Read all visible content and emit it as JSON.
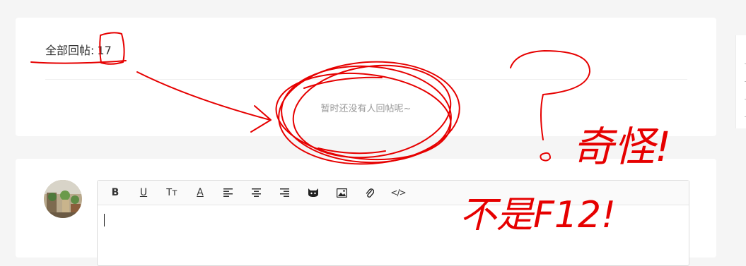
{
  "replies": {
    "label": "全部回帖:",
    "count": "17",
    "empty_message": "暂时还没有人回帖呢~"
  },
  "editor": {
    "toolbar": [
      {
        "name": "bold-button",
        "label": "B",
        "icon": "bold-icon"
      },
      {
        "name": "underline-button",
        "label": "U",
        "icon": "underline-icon"
      },
      {
        "name": "font-size-button",
        "label": "Tт",
        "icon": "text-size-icon"
      },
      {
        "name": "font-color-button",
        "label": "A",
        "icon": "font-color-icon"
      },
      {
        "name": "align-left-button",
        "label": "",
        "icon": "align-left-icon"
      },
      {
        "name": "align-center-button",
        "label": "",
        "icon": "align-center-icon"
      },
      {
        "name": "align-right-button",
        "label": "",
        "icon": "align-right-icon"
      },
      {
        "name": "emoji-button",
        "label": "",
        "icon": "cat-icon"
      },
      {
        "name": "image-button",
        "label": "",
        "icon": "image-icon"
      },
      {
        "name": "attachment-button",
        "label": "",
        "icon": "paperclip-icon"
      },
      {
        "name": "code-button",
        "label": "</>",
        "icon": "code-icon"
      }
    ],
    "input_value": ""
  },
  "annotations": {
    "color": "#e60000",
    "handwritten_text": [
      "奇怪!",
      "不是F12!"
    ]
  },
  "colors": {
    "background": "#f5f5f5",
    "card": "#ffffff",
    "muted_text": "#999999",
    "annotation_red": "#e60000"
  }
}
